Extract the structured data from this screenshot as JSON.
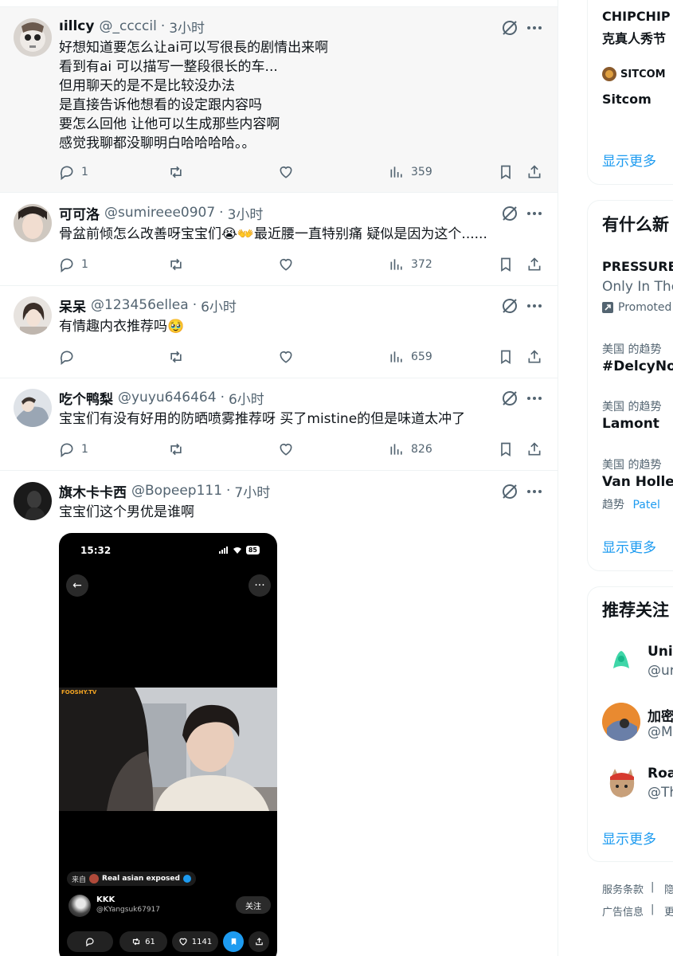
{
  "feed": {
    "posts": [
      {
        "name": "ıillcy",
        "handle": "@_ccccil",
        "time": "3小时",
        "body": "好想知道要怎么让ai可以写很長的剧情出来啊\n看到有ai 可以描写一整段很长的车...\n但用聊天的是不是比较没办法\n是直接告诉他想看的设定跟内容吗\n要怎么回他 让他可以生成那些内容啊\n感觉我聊都没聊明白哈哈哈哈。。",
        "replies": "1",
        "reposts": "",
        "likes": "",
        "views": "359"
      },
      {
        "name": "可可洛",
        "handle": "@sumireee0907",
        "time": "3小时",
        "body": "骨盆前倾怎么改善呀宝宝们😭👐最近腰一直特别痛 疑似是因为这个......",
        "replies": "1",
        "reposts": "",
        "likes": "",
        "views": "372"
      },
      {
        "name": "呆呆",
        "handle": "@123456ellea",
        "time": "6小时",
        "body": "有情趣内衣推荐吗🥹",
        "replies": "",
        "reposts": "",
        "likes": "",
        "views": "659"
      },
      {
        "name": "吃个鸭梨",
        "handle": "@yuyu646464",
        "time": "6小时",
        "body": "宝宝们有没有好用的防晒喷雾推荐呀 买了mistine的但是味道太冲了",
        "replies": "1",
        "reposts": "",
        "likes": "",
        "views": "826"
      },
      {
        "name": "旗木卡卡西",
        "handle": "@Bopeep111",
        "time": "7小时",
        "body": "宝宝们这个男优是谁啊"
      }
    ],
    "media": {
      "time": "15:32",
      "battery": "85",
      "watermark": "FOOSHY.TV",
      "source_prefix": "来自",
      "source_name": "Real asian exposed",
      "username": "KKK",
      "user_handle": "@KYangsuk67917",
      "follow_label": "关注",
      "reposts": "61",
      "likes": "1141"
    }
  },
  "sidebar": {
    "card1": {
      "line1": "CHIPCHIP",
      "line2": "克真人秀节",
      "account": "SITCOM",
      "subtitle": "Sitcom",
      "show_more": "显示更多"
    },
    "trends": {
      "title": "有什么新",
      "promoted": {
        "title": "PRESSURE",
        "subtitle": "Only In The",
        "label": "Promoted"
      },
      "items": [
        {
          "context": "美国 的趋势",
          "name": "#DelcyNoC"
        },
        {
          "context": "美国 的趋势",
          "name": "Lamont"
        },
        {
          "context": "美国 的趋势",
          "name": "Van Hollen",
          "related_prefix": "趋势",
          "related": "Patel"
        }
      ],
      "show_more": "显示更多"
    },
    "follow": {
      "title": "推荐关注",
      "items": [
        {
          "name": "Unip",
          "handle": "@ur"
        },
        {
          "name": "加密",
          "handle": "@Mo"
        },
        {
          "name": "Roa",
          "handle": "@Th"
        }
      ],
      "show_more": "显示更多"
    },
    "footer": {
      "terms": "服务条款",
      "privacy": "隐",
      "ads": "广告信息",
      "more": "更"
    }
  },
  "colors": {
    "accent": "#1d9bf0",
    "muted": "#536471",
    "text": "#0f1419",
    "border": "#eff3f4"
  }
}
